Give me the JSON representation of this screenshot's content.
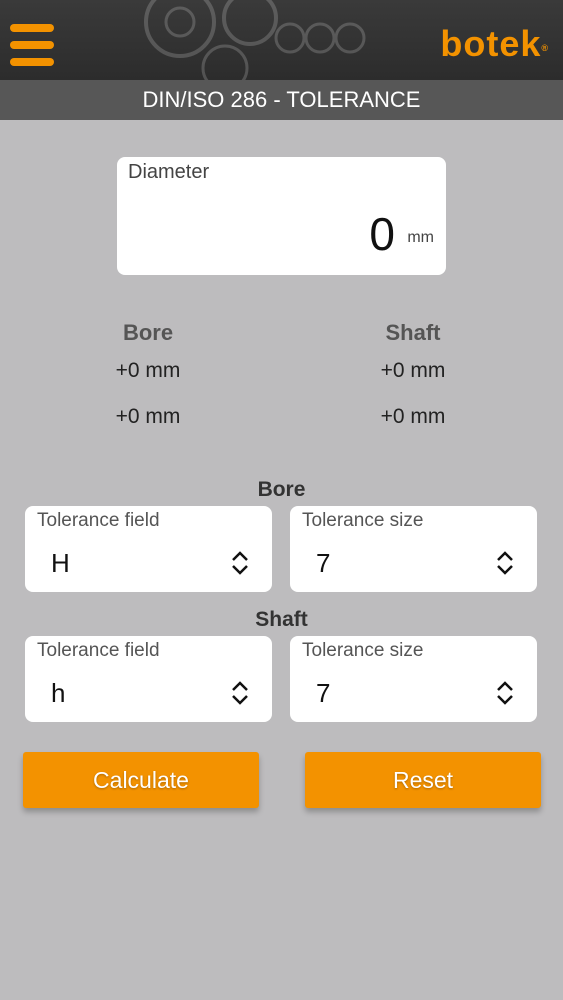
{
  "header": {
    "logo_text": "botek",
    "logo_mark": "®",
    "menu_icon": "hamburger-menu-icon",
    "accent_color": "#f39200"
  },
  "title": "DIN/ISO 286 - TOLERANCE",
  "diameter": {
    "label": "Diameter",
    "value": "0",
    "unit": "mm"
  },
  "results": {
    "bore": {
      "heading": "Bore",
      "upper": "+0 mm",
      "lower": "+0 mm"
    },
    "shaft": {
      "heading": "Shaft",
      "upper": "+0 mm",
      "lower": "+0 mm"
    }
  },
  "bore_section": {
    "heading": "Bore",
    "field": {
      "label": "Tolerance field",
      "value": "H"
    },
    "size": {
      "label": "Tolerance size",
      "value": "7"
    }
  },
  "shaft_section": {
    "heading": "Shaft",
    "field": {
      "label": "Tolerance field",
      "value": "h"
    },
    "size": {
      "label": "Tolerance size",
      "value": "7"
    }
  },
  "buttons": {
    "calculate": "Calculate",
    "reset": "Reset"
  }
}
